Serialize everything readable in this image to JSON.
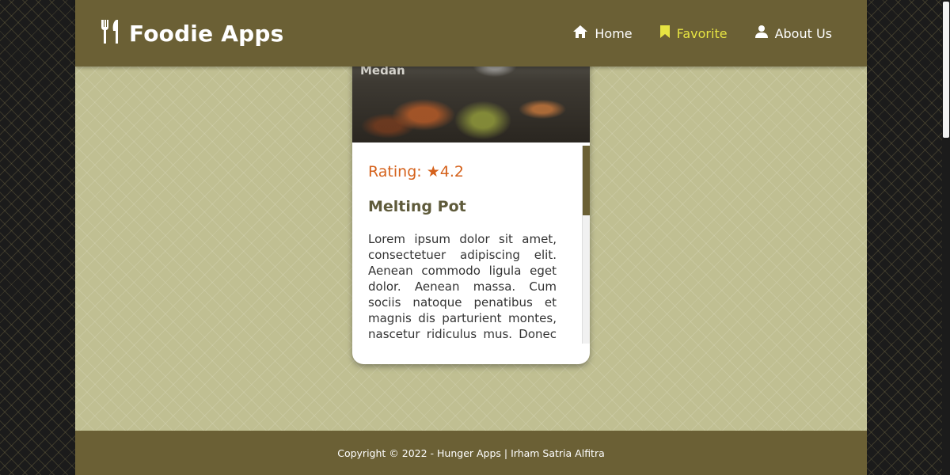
{
  "header": {
    "logo_text": "Foodie Apps",
    "nav": [
      {
        "label": "Home",
        "icon": "home-icon"
      },
      {
        "label": "Favorite",
        "icon": "bookmark-icon",
        "active": true
      },
      {
        "label": "About Us",
        "icon": "user-icon"
      }
    ]
  },
  "restaurant": {
    "city": "Medan",
    "rating_label": "Rating:",
    "rating_value": "★4.2",
    "name": "Melting Pot",
    "description": "Lorem ipsum dolor sit amet, consectetuer adipiscing elit. Aenean commodo ligula eget dolor. Aenean massa. Cum sociis natoque penatibus et magnis dis parturient montes, nascetur ridiculus mus. Donec quam felis, ultricies nec, pellentesque eu, pretium quis, sem."
  },
  "footer": {
    "copyright": "Copyright © 2022 - Hunger Apps | Irham Satria Alfitra"
  },
  "colors": {
    "header_bg": "#6b6035",
    "page_bg": "#c0bf92",
    "active_nav": "#e7e442",
    "rating": "#d5621c"
  }
}
